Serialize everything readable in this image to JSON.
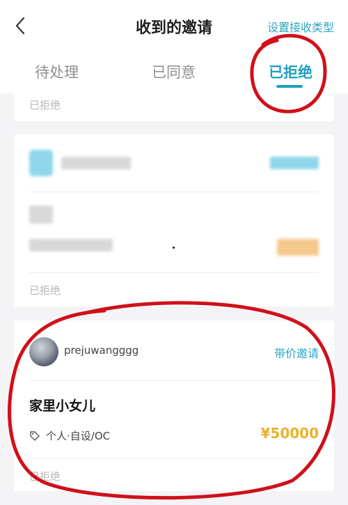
{
  "header": {
    "back_icon": "chevron-left-icon",
    "title": "收到的邀请",
    "set_type_label": "设置接收类型"
  },
  "tabs": [
    {
      "label": "待处理",
      "active": false
    },
    {
      "label": "已同意",
      "active": false
    },
    {
      "label": "已拒绝",
      "active": true
    }
  ],
  "cards": [
    {
      "status": "已拒绝"
    },
    {
      "status": "已拒绝"
    },
    {
      "username": "prejuwangggg",
      "invite_type": "带价邀请",
      "work_title": "家里小女儿",
      "tag_icon": "tag-icon",
      "tag_text": "个人·自设/OC",
      "price": "¥50000",
      "status": "已拒绝"
    }
  ],
  "colors": {
    "accent": "#1fa0c0",
    "price": "#e9b22d",
    "annotation": "#d0101a"
  }
}
